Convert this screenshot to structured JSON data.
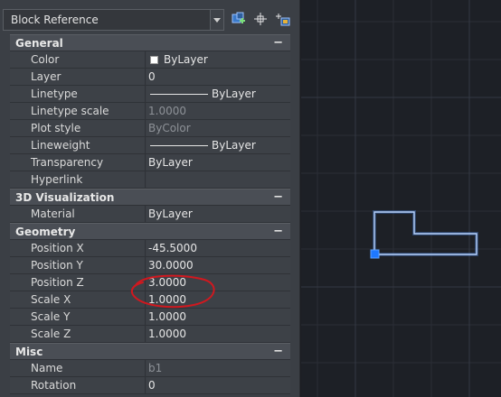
{
  "palette": {
    "object_type": "Block Reference",
    "toolbar": {
      "quick_select_icon": "quick-select-icon",
      "select_objects_icon": "select-objects-icon",
      "toggle_pickadd_icon": "toggle-pickadd-icon"
    }
  },
  "sections": {
    "general": {
      "title": "General",
      "toggle": "−",
      "rows": [
        {
          "name": "Color",
          "value": "ByLayer"
        },
        {
          "name": "Layer",
          "value": "0"
        },
        {
          "name": "Linetype",
          "value": "ByLayer"
        },
        {
          "name": "Linetype scale",
          "value": "1.0000"
        },
        {
          "name": "Plot style",
          "value": "ByColor"
        },
        {
          "name": "Lineweight",
          "value": "ByLayer"
        },
        {
          "name": "Transparency",
          "value": "ByLayer"
        },
        {
          "name": "Hyperlink",
          "value": ""
        }
      ]
    },
    "visualization": {
      "title": "3D Visualization",
      "toggle": "−",
      "rows": [
        {
          "name": "Material",
          "value": "ByLayer"
        }
      ]
    },
    "geometry": {
      "title": "Geometry",
      "toggle": "−",
      "rows": [
        {
          "name": "Position X",
          "value": "-45.5000"
        },
        {
          "name": "Position Y",
          "value": "30.0000"
        },
        {
          "name": "Position Z",
          "value": "3.0000"
        },
        {
          "name": "Scale X",
          "value": "1.0000"
        },
        {
          "name": "Scale Y",
          "value": "1.0000"
        },
        {
          "name": "Scale Z",
          "value": "1.0000"
        }
      ]
    },
    "misc": {
      "title": "Misc",
      "toggle": "−",
      "rows": [
        {
          "name": "Name",
          "value": "b1"
        },
        {
          "name": "Rotation",
          "value": "0"
        }
      ]
    }
  },
  "colors": {
    "selection_highlight": "#6fa8ff",
    "grip": "#1e78ff",
    "annotation_circle": "#d0181f",
    "canvas_background": "#1d2026",
    "grid_line": "#2c3038"
  }
}
